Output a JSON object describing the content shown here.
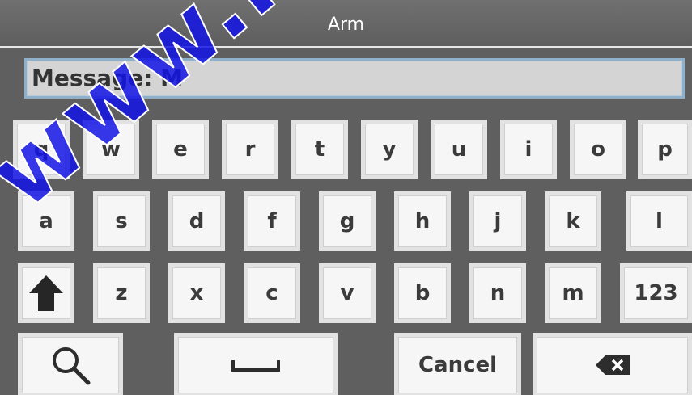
{
  "title": "Arm",
  "message": {
    "label": "Message:",
    "value": "M"
  },
  "keyboard": {
    "row1": [
      "q",
      "w",
      "e",
      "r",
      "t",
      "y",
      "u",
      "i",
      "o",
      "p"
    ],
    "row2": [
      "a",
      "s",
      "d",
      "f",
      "g",
      "h",
      "j",
      "k",
      "l"
    ],
    "row3": [
      "z",
      "x",
      "c",
      "v",
      "b",
      "n",
      "m"
    ],
    "numbers_key": "123",
    "cancel_label": "Cancel",
    "shift_icon": "arrow-up-icon",
    "search_icon": "magnifier-icon",
    "space_icon": "space-bar-icon",
    "backspace_icon": "backspace-icon"
  },
  "watermark": "www.msealarm",
  "colors": {
    "background": "#5f5f5f",
    "key_face": "#f6f6f6",
    "key_text": "#3b3b3b",
    "field_border": "#8fb0c8",
    "watermark": "#1414e6"
  }
}
